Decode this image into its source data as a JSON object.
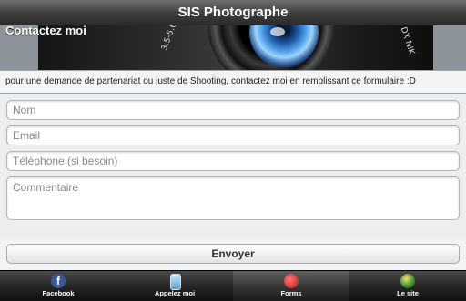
{
  "header": {
    "title": "SIS Photographe"
  },
  "banner": {
    "section_title": "Contactez moi",
    "lens_text_left": "3.5-5.6G",
    "lens_text_right": "S DX NIK"
  },
  "intro": "pour une demande de partenariat ou juste de Shooting, contactez moi en remplissant ce formulaire :D",
  "form": {
    "name_placeholder": "Nom",
    "email_placeholder": "Email",
    "phone_placeholder": "Téléphone (si besoin)",
    "comment_placeholder": "Commentaire",
    "submit_label": "Envoyer"
  },
  "tabs": [
    {
      "label": "Facebook",
      "icon": "facebook-icon"
    },
    {
      "label": "Appelez moi",
      "icon": "phone-icon"
    },
    {
      "label": "Forms",
      "icon": "forms-icon"
    },
    {
      "label": "Le site",
      "icon": "globe-icon"
    }
  ],
  "active_tab": "Forms"
}
